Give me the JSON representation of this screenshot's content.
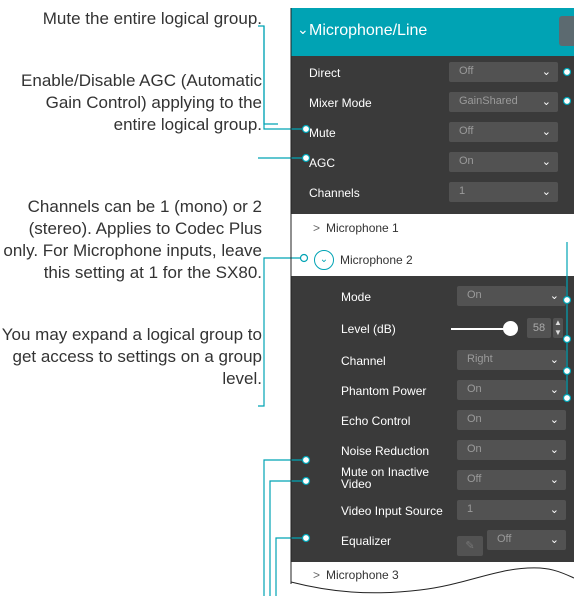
{
  "annotations": {
    "mute_group": "Mute the entire logical group.",
    "agc": "Enable/Disable AGC (Automatic Gain Control) applying to the entire logical group.",
    "channels": "Channels can be 1 (mono) or 2 (stereo). Applies to Codec Plus only. For Microphone inputs, leave this setting at 1 for the SX80.",
    "expand": "You may expand a logical group to get access to settings on a group level."
  },
  "panel": {
    "title": "Microphone/Line",
    "group_settings": [
      {
        "label": "Direct",
        "value": "Off"
      },
      {
        "label": "Mixer Mode",
        "value": "GainShared"
      },
      {
        "label": "Mute",
        "value": "Off"
      },
      {
        "label": "AGC",
        "value": "On"
      },
      {
        "label": "Channels",
        "value": "1"
      }
    ],
    "microphone_1": "Microphone 1",
    "microphone_2": "Microphone 2",
    "mic2_settings": [
      {
        "label": "Mode",
        "value": "On"
      },
      {
        "label": "Level (dB)",
        "value": "58"
      },
      {
        "label": "Channel",
        "value": "Right"
      },
      {
        "label": "Phantom Power",
        "value": "On"
      },
      {
        "label": "Echo Control",
        "value": "On"
      },
      {
        "label": "Noise Reduction",
        "value": "On"
      },
      {
        "label": "Mute on Inactive Video",
        "value": "Off"
      },
      {
        "label": "Video Input Source",
        "value": "1"
      },
      {
        "label": "Equalizer",
        "value": "Off"
      }
    ],
    "microphone_3": "Microphone 3"
  },
  "colors": {
    "accent": "#00a3b4",
    "panel_dark": "#3a3a3a",
    "dropdown": "#525252"
  }
}
